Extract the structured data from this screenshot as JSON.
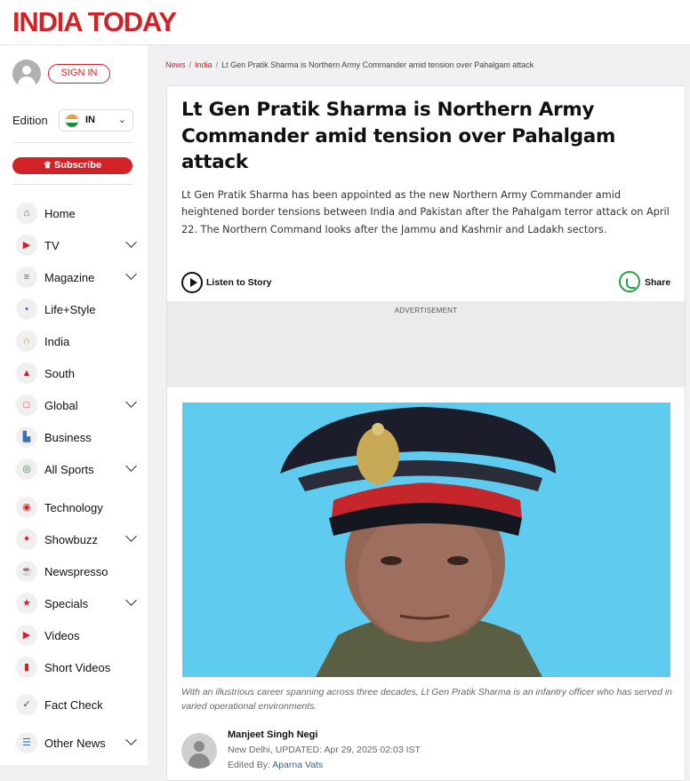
{
  "header": {
    "logo": "INDIA TODAY"
  },
  "sidebar": {
    "signin_label": "SIGN IN",
    "edition_label": "Edition",
    "edition_value": "IN",
    "subscribe_label": "Subscribe",
    "items": [
      {
        "label": "Home",
        "icon": "home-icon",
        "has_submenu": false
      },
      {
        "label": "TV",
        "icon": "live-tv-icon",
        "has_submenu": true
      },
      {
        "label": "Magazine",
        "icon": "magazine-icon",
        "has_submenu": true
      },
      {
        "label": "Life+Style",
        "icon": "cocktail-icon",
        "has_submenu": false
      },
      {
        "label": "India",
        "icon": "india-gate-icon",
        "has_submenu": false
      },
      {
        "label": "South",
        "icon": "temple-icon",
        "has_submenu": false
      },
      {
        "label": "Global",
        "icon": "globe-icon",
        "has_submenu": true
      },
      {
        "label": "Business",
        "icon": "bar-chart-icon",
        "has_submenu": false
      },
      {
        "label": "All Sports",
        "icon": "sports-icon",
        "has_submenu": true
      },
      {
        "label": "Technology",
        "icon": "technology-icon",
        "has_submenu": false
      },
      {
        "label": "Showbuzz",
        "icon": "showbuzz-icon",
        "has_submenu": true
      },
      {
        "label": "Newspresso",
        "icon": "coffee-icon",
        "has_submenu": false
      },
      {
        "label": "Specials",
        "icon": "specials-icon",
        "has_submenu": true
      },
      {
        "label": "Videos",
        "icon": "video-icon",
        "has_submenu": false
      },
      {
        "label": "Short Videos",
        "icon": "short-video-icon",
        "has_submenu": false
      },
      {
        "label": "Fact Check",
        "icon": "fact-check-icon",
        "has_submenu": false
      },
      {
        "label": "Other News",
        "icon": "news-icon",
        "has_submenu": true
      }
    ]
  },
  "breadcrumb": {
    "items": [
      "News",
      "India"
    ],
    "current": "Lt Gen Pratik Sharma is Northern Army Commander amid tension over Pahalgam attack"
  },
  "article": {
    "headline": "Lt Gen Pratik Sharma is Northern Army Commander amid tension over Pahalgam attack",
    "summary": "Lt Gen Pratik Sharma has been appointed as the new Northern Army Commander amid heightened border tensions between India and Pakistan after the Pahalgam terror attack on April 22. The Northern Command looks after the Jammu and Kashmir and Ladakh sectors.",
    "listen_label": "Listen to Story",
    "share_label": "Share",
    "ad_label": "ADVERTISEMENT",
    "caption": "With an illustrious career spanning across three decades, Lt Gen Pratik Sharma is an infantry officer who has served in varied operational environments.",
    "author": "Manjeet Singh Negi",
    "location": "New Delhi,",
    "updated": "UPDATED: Apr 29, 2025 02:03 IST",
    "edited_by_label": "Edited By:",
    "editor": "Aparna Vats"
  },
  "colors": {
    "brand": "#d12227",
    "photo_bg": "#5fcbee",
    "whatsapp": "#25a244"
  }
}
